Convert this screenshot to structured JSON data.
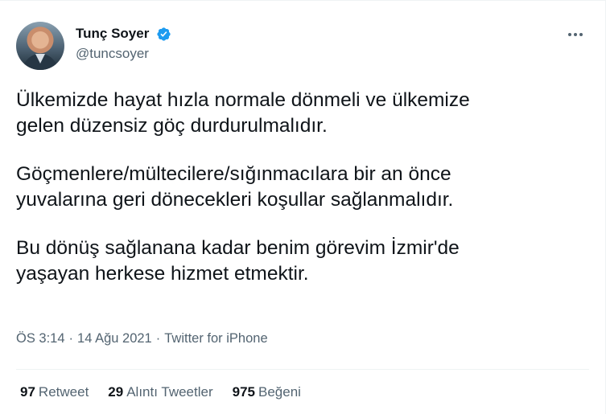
{
  "author": {
    "display_name": "Tunç Soyer",
    "handle": "@tuncsoyer",
    "verified_color": "#1d9bf0"
  },
  "tweet": {
    "paragraphs": [
      "Ülkemizde hayat hızla normale dönmeli ve ülkemize\ngelen düzensiz göç durdurulmalıdır.",
      "Göçmenlere/mültecilere/sığınmacılara bir an önce\nyuvalarına geri dönecekleri koşullar sağlanmalıdır.",
      "Bu dönüş sağlanana kadar benim görevim İzmir'de\nyaşayan herkese hizmet etmektir."
    ]
  },
  "meta": {
    "time": "ÖS 3:14",
    "separator": "·",
    "date": "14 Ağu 2021",
    "source": "Twitter for iPhone"
  },
  "stats": {
    "retweets": {
      "count": "97",
      "label": "Retweet"
    },
    "quotes": {
      "count": "29",
      "label": "Alıntı Tweetler"
    },
    "likes": {
      "count": "975",
      "label": "Beğeni"
    }
  },
  "icons": {
    "more": "more-horizontal-icon",
    "verified": "verified-badge-icon"
  }
}
